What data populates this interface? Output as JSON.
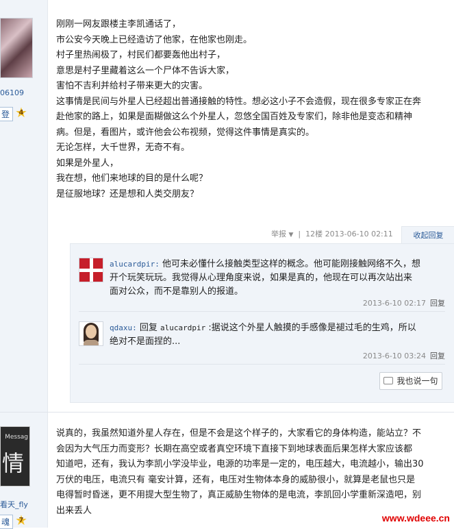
{
  "post1": {
    "author_uid": "06109",
    "rank_label": "登",
    "rank_level": "4",
    "lines": [
      "刚刚一网友跟楼主李凯通话了，",
      "市公安今天晚上已经造访了他家，在他家也刚走。",
      "村子里热闹极了，村民们都要轰他出村子，",
      "意思是村子里藏着这么一个尸体不告诉大家，",
      "害怕不吉利并给村子带来更大的灾害。",
      "这事情是民间与外星人已经超出普通接触的特性。想必这小子不会造假，现在很多专家正在奔",
      "赴他家的路上，如果是面糊做这么个外星人，忽悠全国百姓及专家们，除非他是变态和精神",
      "病。但是，看图片，或许他会公布视频，觉得这件事情是真实的。",
      "无论怎样，大千世界，无奇不有。",
      "如果是外星人，",
      "我在想，他们来地球的目的是什么呢？",
      "是征服地球？还是想和人类交朋友？"
    ],
    "meta": {
      "report_label": "举报",
      "report_caret": "▼",
      "floor": "12楼",
      "datetime": "2013-06-10 02:11",
      "separator": "|"
    },
    "collapse_label": "收起回复"
  },
  "replies": [
    {
      "avatar_icon": "flag-avatar-icon",
      "name": "alucardpir:",
      "text_lines": [
        "他可未必懂什么接触类型这样的概念。他可能刚接触网络不久，想",
        "开个玩笑玩玩。我觉得从心理角度来说，如果是真的，他现在可以再次站出来",
        "面对公众，而不是靠别人的报道。"
      ],
      "time": "2013-6-10 02:17",
      "reply_label": "回复"
    },
    {
      "avatar_icon": "woman-avatar-icon",
      "name": "qdaxu:",
      "prefix": "回复 ",
      "target": "alucardpir",
      "text_first": " :据说这个外星人触摸的手感像是褪过毛的生鸡，所以",
      "text_second": "绝对不是面捏的...",
      "time": "2013-6-10 03:24",
      "reply_label": "回复"
    }
  ],
  "say_button": "我也说一句",
  "post2": {
    "avatar_text_small": "Messag",
    "avatar_text_big": "情",
    "author_name": "看天_fly",
    "rank_label": "魂",
    "rank_level": "7",
    "lines": [
      "说真的，我虽然知道外星人存在，但是不会是这个样子的，大家看它的身体构造，能站立？不",
      "会因为大气压力而变形？长期在高空或者真空环境下直接下到地球表面后果怎样大家应该都",
      "知道吧，还有，我认为李凯小学没毕业，电源的功率是一定的，电压越大，电流越小，输出30",
      "万伏的电压，电流只有 毫安计算，还有，电压对生物体本身的威胁很小，就算是老鼠也只是",
      "电得暂时昏迷，更不用提大型生物了，真正威胁生物体的是电流，李凯回小学重新深造吧，别",
      "出来丢人"
    ]
  },
  "watermark": "www.wdeee.cn",
  "colors": {
    "link": "#2a5a98",
    "panel": "#f0f4f9",
    "watermark": "#e00000"
  }
}
